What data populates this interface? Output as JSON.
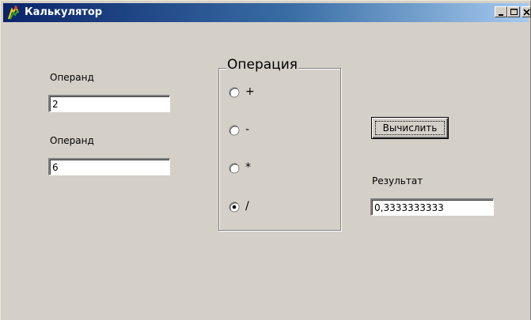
{
  "window": {
    "title": "Калькулятор",
    "title_bar_colors": {
      "start": "#0a246a",
      "end": "#a6caf0"
    },
    "background": "#d4d0c8",
    "controls": [
      "minimize-icon",
      "maximize-icon",
      "close-icon"
    ]
  },
  "operand1": {
    "label": "Операнд",
    "value": "2"
  },
  "operand2": {
    "label": "Операнд",
    "value": "6"
  },
  "operation": {
    "group_label": "Операция",
    "options": [
      {
        "label": "+",
        "selected": false
      },
      {
        "label": "-",
        "selected": false
      },
      {
        "label": "*",
        "selected": false
      },
      {
        "label": "/",
        "selected": true
      }
    ]
  },
  "compute_button": {
    "label": "Вычислить"
  },
  "result": {
    "label": "Результат",
    "value": "0,3333333333"
  }
}
